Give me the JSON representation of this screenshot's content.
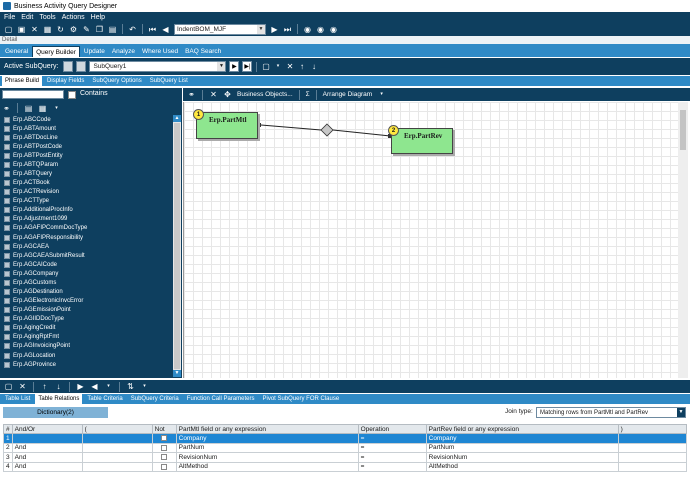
{
  "window": {
    "title": "Business Activity Query Designer"
  },
  "menu": [
    "File",
    "Edit",
    "Tools",
    "Actions",
    "Help"
  ],
  "toolbar1": {
    "query_combo_value": "IndentBOM_MJF"
  },
  "detail_label": "Detail",
  "main_tabs": [
    {
      "label": "General",
      "active": false
    },
    {
      "label": "Query Builder",
      "active": true
    },
    {
      "label": "Update",
      "active": false
    },
    {
      "label": "Analyze",
      "active": false
    },
    {
      "label": "Where Used",
      "active": false
    },
    {
      "label": "BAQ Search",
      "active": false
    }
  ],
  "subquery_bar": {
    "label": "Active SubQuery:",
    "value": "SubQuery1"
  },
  "phrase_tabs": [
    {
      "label": "Phrase Build",
      "active": true
    },
    {
      "label": "Display Fields",
      "active": false
    },
    {
      "label": "SubQuery Options",
      "active": false
    },
    {
      "label": "SubQuery List",
      "active": false
    }
  ],
  "left_panel": {
    "search_value": "",
    "contains_label": "Contains",
    "tables": [
      "Erp.ABCCode",
      "Erp.ABTAmount",
      "Erp.ABTDocLine",
      "Erp.ABTPostCode",
      "Erp.ABTPostEntity",
      "Erp.ABTQParam",
      "Erp.ABTQuery",
      "Erp.ACTBook",
      "Erp.ACTRevision",
      "Erp.ACTType",
      "Erp.AdditionalProcInfo",
      "Erp.Adjustment1099",
      "Erp.AGAFIPCommDocType",
      "Erp.AGAFIPResponsibility",
      "Erp.AGCAEA",
      "Erp.AGCAEASubmitResult",
      "Erp.AGCAICode",
      "Erp.AGCompany",
      "Erp.AGCustoms",
      "Erp.AGDestination",
      "Erp.AGElectronicInvcError",
      "Erp.AGEmissionPoint",
      "Erp.AGIIDDocType",
      "Erp.AgingCredit",
      "Erp.AgingRptFmt",
      "Erp.AGInvoicingPoint",
      "Erp.AGLocation",
      "Erp.AGProvince"
    ]
  },
  "canvas_toolbar": {
    "business_objects": "Business Objects...",
    "sigma": "Σ",
    "arrange": "Arrange Diagram"
  },
  "diagram": {
    "nodes": [
      {
        "num": "1",
        "label": "Erp.PartMtl"
      },
      {
        "num": "2",
        "label": "Erp.PartRev"
      }
    ]
  },
  "lower_tabs": [
    {
      "label": "Table List",
      "active": false
    },
    {
      "label": "Table Relations",
      "active": true
    },
    {
      "label": "Table Criteria",
      "active": false
    },
    {
      "label": "SubQuery Criteria",
      "active": false
    },
    {
      "label": "Function Call Parameters",
      "active": false
    },
    {
      "label": "Pivot SubQuery FOR Clause",
      "active": false
    }
  ],
  "relations": {
    "dictionary_tab": "Dictionary(2)",
    "join_type_label": "Join type:",
    "join_type_value": "Matching rows from PartMtl and PartRev",
    "columns": [
      "And/Or",
      "(",
      "Not",
      "PartMtl field or any expression",
      "Operation",
      "PartRev field or any expression",
      ")"
    ],
    "rows": [
      {
        "n": "1",
        "andor": "",
        "lp": "",
        "left": "Company",
        "op": "=",
        "right": "Company",
        "rp": "",
        "selected": true
      },
      {
        "n": "2",
        "andor": "And",
        "lp": "",
        "left": "PartNum",
        "op": "=",
        "right": "PartNum",
        "rp": "",
        "selected": false
      },
      {
        "n": "3",
        "andor": "And",
        "lp": "",
        "left": "RevisionNum",
        "op": "=",
        "right": "RevisionNum",
        "rp": "",
        "selected": false
      },
      {
        "n": "4",
        "andor": "And",
        "lp": "",
        "left": "AltMethod",
        "op": "=",
        "right": "AltMethod",
        "rp": "",
        "selected": false
      }
    ]
  },
  "colors": {
    "dark": "#0e3f5f",
    "accent": "#2f8ac6",
    "node": "#8ee68f",
    "selection": "#1e86d3"
  }
}
